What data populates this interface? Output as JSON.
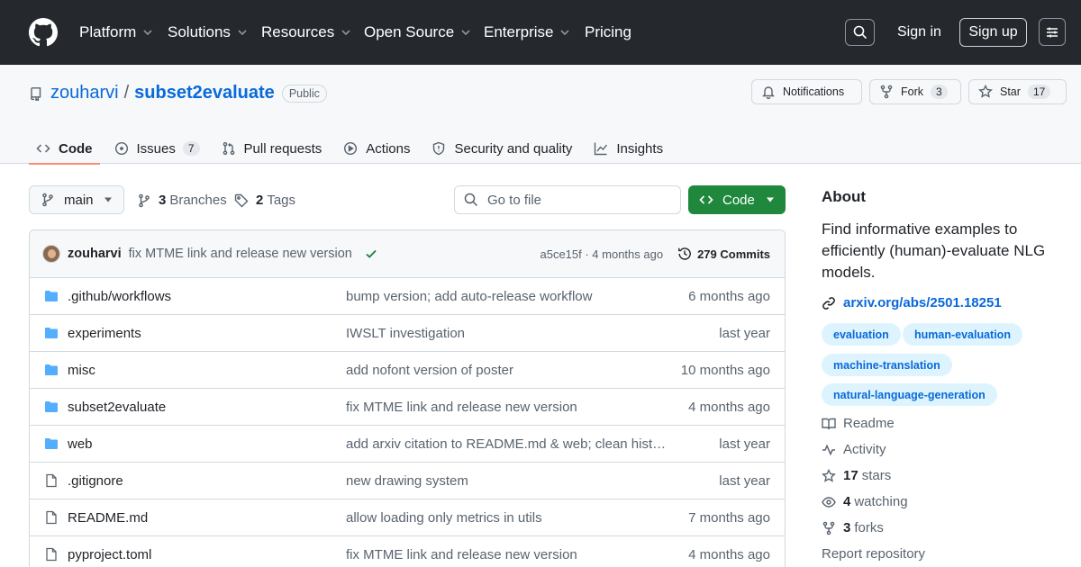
{
  "nav": {
    "items": [
      "Platform",
      "Solutions",
      "Resources",
      "Open Source",
      "Enterprise",
      "Pricing"
    ],
    "sign_in": "Sign in",
    "sign_up": "Sign up"
  },
  "repo": {
    "owner": "zouharvi",
    "separator": "/",
    "name": "subset2evaluate",
    "visibility": "Public",
    "notifications_label": "Notifications",
    "fork_label": "Fork",
    "fork_count": "3",
    "star_label": "Star",
    "star_count": "17"
  },
  "tabs": [
    {
      "label": "Code",
      "active": true
    },
    {
      "label": "Issues",
      "count": "7"
    },
    {
      "label": "Pull requests"
    },
    {
      "label": "Actions"
    },
    {
      "label": "Security and quality"
    },
    {
      "label": "Insights"
    }
  ],
  "toolbar": {
    "branch": "main",
    "branches_count": "3",
    "branches_label": "Branches",
    "tags_count": "2",
    "tags_label": "Tags",
    "goto_placeholder": "Go to file",
    "code_label": "Code"
  },
  "latest_commit": {
    "author": "zouharvi",
    "message": "fix MTME link and release new version",
    "sha_time": "a5ce15f · 4 months ago",
    "commits_label": "279 Commits"
  },
  "files": [
    {
      "type": "dir",
      "name": ".github/workflows",
      "message": "bump version; add auto-release workflow",
      "date": "6 months ago"
    },
    {
      "type": "dir",
      "name": "experiments",
      "message": "IWSLT investigation",
      "date": "last year"
    },
    {
      "type": "dir",
      "name": "misc",
      "message": "add nofont version of poster",
      "date": "10 months ago"
    },
    {
      "type": "dir",
      "name": "subset2evaluate",
      "message": "fix MTME link and release new version",
      "date": "4 months ago"
    },
    {
      "type": "dir",
      "name": "web",
      "message": "add arxiv citation to README.md & web; clean histo…",
      "date": "last year"
    },
    {
      "type": "file",
      "name": ".gitignore",
      "message": "new drawing system",
      "date": "last year"
    },
    {
      "type": "file",
      "name": "README.md",
      "message": "allow loading only metrics in utils",
      "date": "7 months ago"
    },
    {
      "type": "file",
      "name": "pyproject.toml",
      "message": "fix MTME link and release new version",
      "date": "4 months ago"
    }
  ],
  "about": {
    "title": "About",
    "description": "Find informative examples to efficiently (human)-evaluate NLG models.",
    "link": "arxiv.org/abs/2501.18251",
    "topics": [
      "evaluation",
      "human-evaluation",
      "machine-translation",
      "natural-language-generation"
    ],
    "readme": "Readme",
    "activity": "Activity",
    "stars_count": "17",
    "stars_label": "stars",
    "watching_count": "4",
    "watching_label": "watching",
    "forks_count": "3",
    "forks_label": "forks",
    "report": "Report repository"
  },
  "colors": {
    "nav_bg": "#25292e",
    "link": "#0969da",
    "green": "#1f883d",
    "active_tab_underline": "#fd8c73",
    "folder": "#54aeff"
  }
}
